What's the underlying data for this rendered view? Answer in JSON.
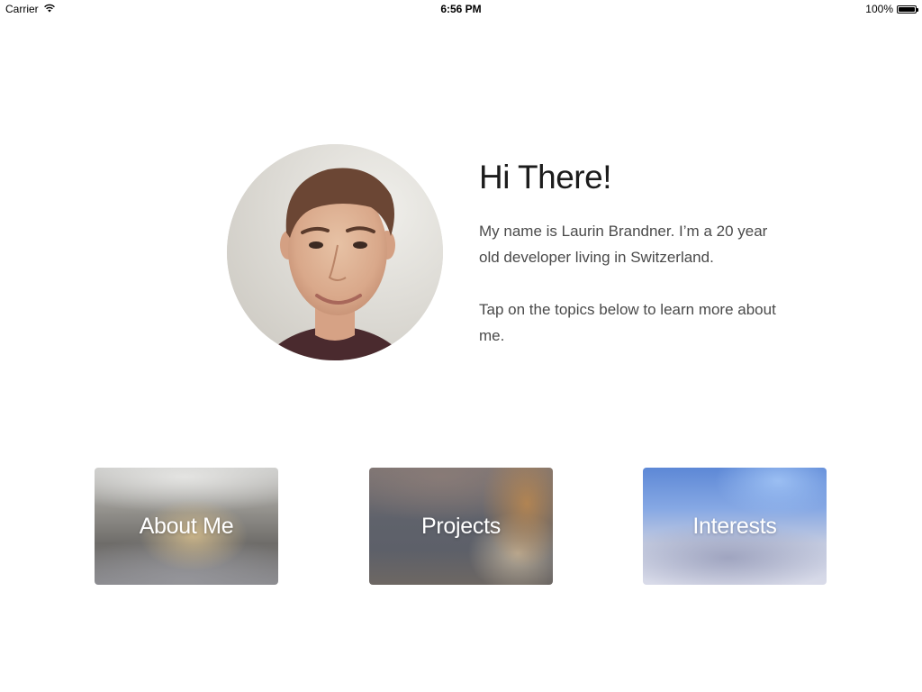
{
  "status_bar": {
    "carrier": "Carrier",
    "time": "6:56 PM",
    "battery_text": "100%",
    "battery_level": 1.0,
    "wifi_icon": "wifi-icon",
    "battery_icon": "battery-icon"
  },
  "intro": {
    "avatar_icon": "profile-photo",
    "greeting": "Hi There!",
    "bio": "My name is Laurin Brandner. I’m a 20 year old developer living in Switzerland.",
    "hint": "Tap on the topics below to learn more about me."
  },
  "topics": [
    {
      "label": "About Me"
    },
    {
      "label": "Projects"
    },
    {
      "label": "Interests"
    }
  ],
  "colors": {
    "background": "#ffffff",
    "heading": "#1c1c1c",
    "body_text": "#4a4a4a",
    "card_text": "#ffffff"
  }
}
